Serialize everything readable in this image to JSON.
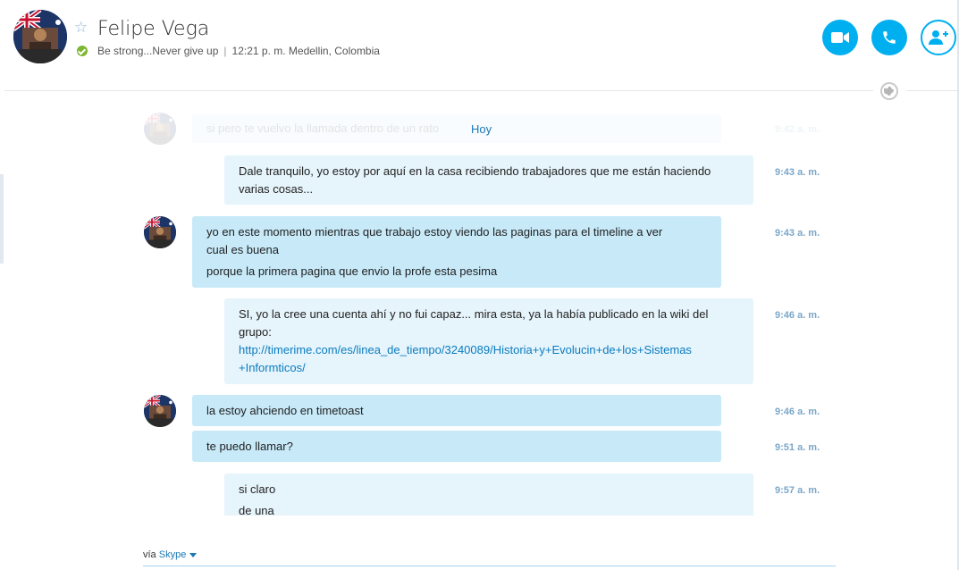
{
  "contact": {
    "name": "Felipe Vega",
    "mood": "Be strong...Never give up",
    "local_time": "12:21 p. m. Medellin, Colombia",
    "presence_color": "#7cb82f"
  },
  "header_actions": {
    "video_icon": "video-camera-icon",
    "call_icon": "phone-icon",
    "add_icon": "add-contact-icon",
    "accent": "#00aff0"
  },
  "faded_message": {
    "text": "si pero te vuelvo la llamada dentro de un rato",
    "time": "9:42 a. m."
  },
  "day_label": "Hoy",
  "messages": [
    {
      "lines": [
        "Dale tranquilo, yo estoy por aquí en la casa recibiendo trabajadores que me están haciendo",
        "varias cosas..."
      ],
      "time": "9:43 a. m."
    },
    {
      "lines": [
        "yo en este momento mientras que trabajo estoy viendo las paginas para el timeline a ver",
        "cual es buena",
        "porque la primera pagina que envio la profe esta pesima"
      ],
      "time": "9:43 a. m."
    },
    {
      "lines": [
        "SI, yo la cree una cuenta ahí y no fui capaz... mira esta, ya la había publicado en la wiki del",
        "grupo:"
      ],
      "link": [
        "http://timerime.com/es/linea_de_tiempo/3240089/Historia+y+Evolucin+de+los+Sistemas",
        "+Informticos/"
      ],
      "time": "9:46 a. m."
    },
    {
      "lines": [
        "la estoy ahciendo en timetoast"
      ],
      "time": "9:46 a. m."
    },
    {
      "lines": [
        "te puedo llamar?"
      ],
      "time": "9:51 a. m."
    },
    {
      "lines": [
        "si claro",
        "de una"
      ],
      "time": "9:57 a. m."
    }
  ],
  "composer": {
    "via_label": "vía",
    "service": "Skype"
  }
}
